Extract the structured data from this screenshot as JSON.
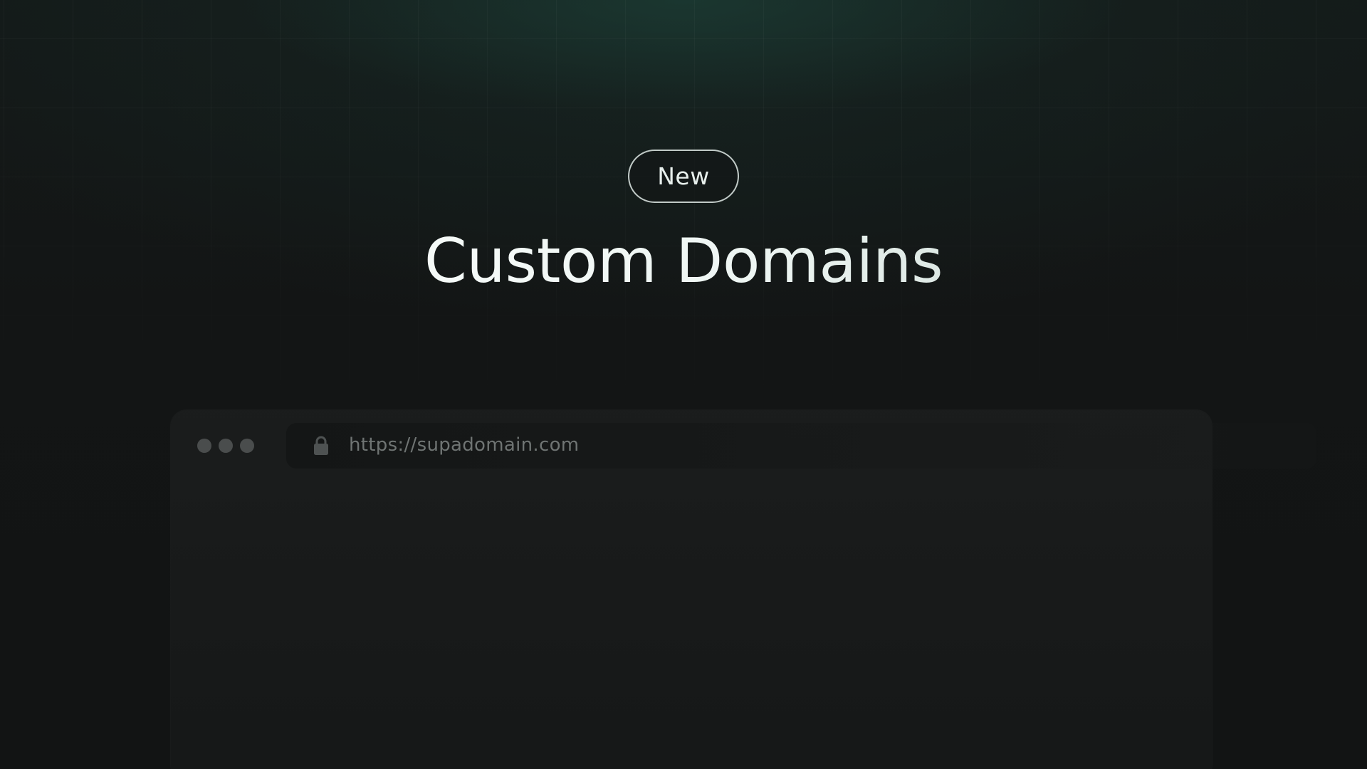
{
  "hero": {
    "badge_label": "New",
    "title": "Custom Domains"
  },
  "browser": {
    "window_controls": [
      "dot",
      "dot",
      "dot"
    ],
    "lock_icon": "lock-icon",
    "url": "https://supadomain.com"
  },
  "colors": {
    "background": "#121414",
    "accent_glow": "#1e463c",
    "title_text": "#ffffff",
    "url_text": "#6f7473",
    "window_dot": "#4a4d4d"
  }
}
